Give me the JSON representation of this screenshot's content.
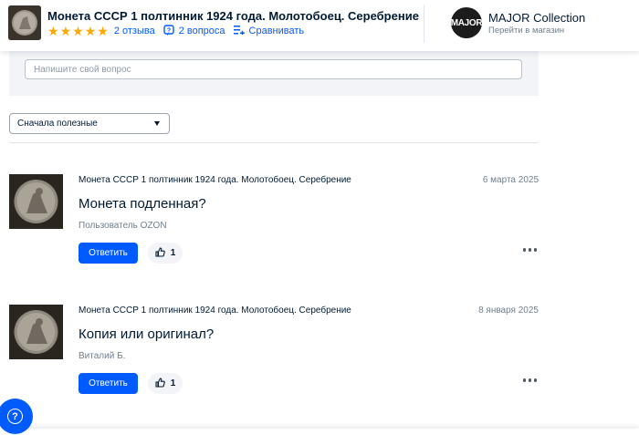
{
  "header": {
    "product_title": "Монета СССР 1 полтинник 1924 года. Молотобоец. Серебрение",
    "rating_stars": 5,
    "reviews_link": "2 отзыва",
    "questions_link": "2 вопроса",
    "compare_link": "Сравнивать",
    "store": {
      "logo_text": "MAJOR",
      "name": "MAJOR Collection",
      "link": "Перейти в магазин"
    }
  },
  "ask": {
    "placeholder": "Напишите свой вопрос"
  },
  "sort": {
    "selected": "Сначала полезные"
  },
  "questions": [
    {
      "product": "Монета СССР 1 полтинник 1924 года. Молотобоец. Серебрение",
      "date": "6 марта 2025",
      "text": "Монета подленная?",
      "author": "Пользователь OZON",
      "reply_label": "Ответить",
      "likes": "1"
    },
    {
      "product": "Монета СССР 1 полтинник 1924 года. Молотобоец. Серебрение",
      "date": "8 января 2025",
      "text": "Копия или оригинал?",
      "author": "Виталий Б.",
      "reply_label": "Ответить",
      "likes": "1"
    }
  ],
  "colors": {
    "accent": "#005bff",
    "star": "#ffa800",
    "text": "#001a34",
    "muted": "#707f8d"
  },
  "icons": {
    "star": "star-icon",
    "questions": "question-bubble-icon",
    "compare": "compare-list-icon",
    "like": "thumbs-up-icon",
    "more": "more-dots-icon",
    "help": "help-question-icon",
    "caret": "chevron-down-icon"
  }
}
